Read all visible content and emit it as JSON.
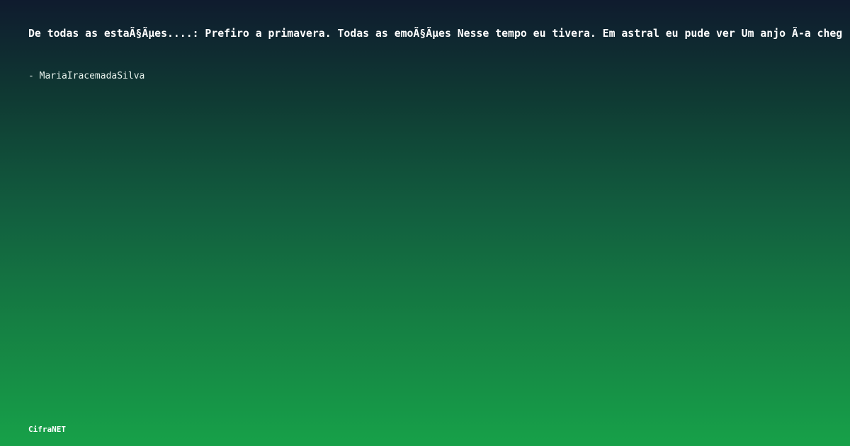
{
  "quote": {
    "text": "De todas as estaÃ§Ãµes....: Prefiro a primavera. Todas as emoÃ§Ãµes Nesse tempo eu tivera. Em astral eu pude ver Um anjo Ã-a cheg"
  },
  "author": {
    "text": "- MariaIracemadaSilva"
  },
  "brand": {
    "label": "CifraNET"
  }
}
